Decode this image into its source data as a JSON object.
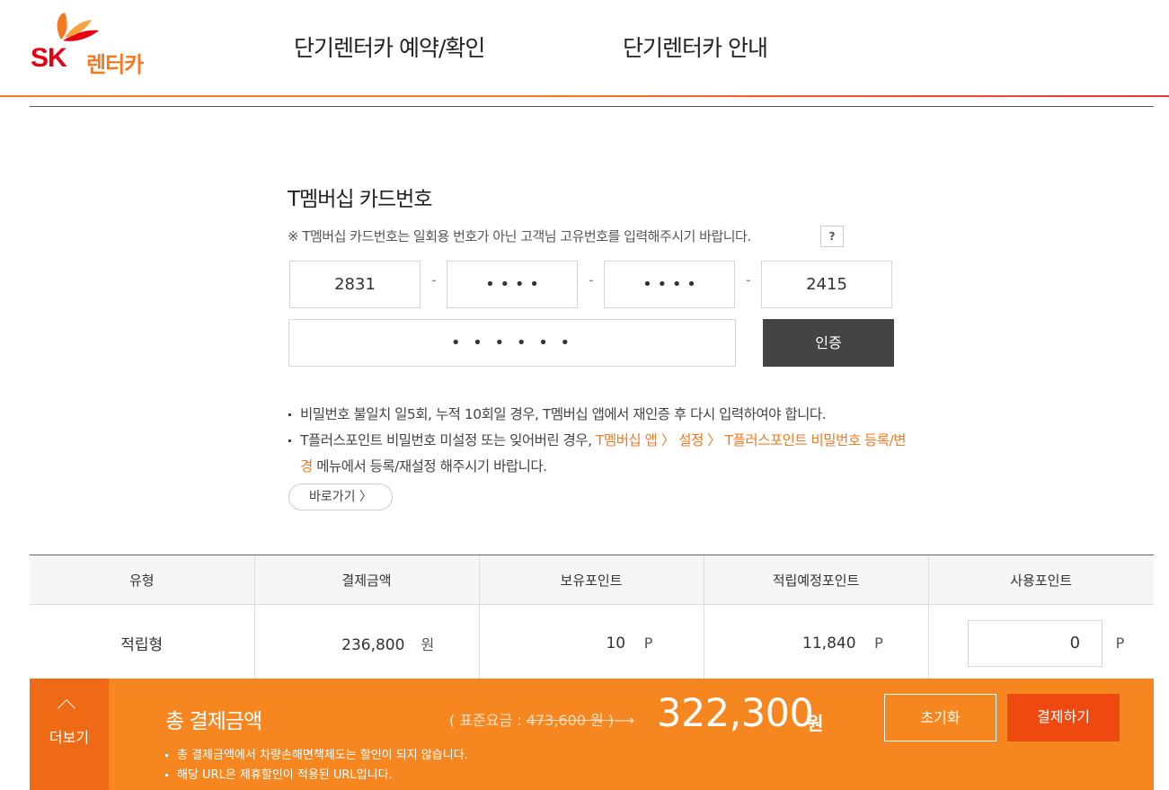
{
  "header": {
    "logo_text": "SK",
    "logo_sub": "렌터카",
    "nav": [
      "단기렌터카 예약/확인",
      "단기렌터카 안내"
    ]
  },
  "membership": {
    "title": "T멤버십 카드번호",
    "notice": "※ T멤버십 카드번호는 일회용 번호가 아닌 고객님 고유번호를 입력해주시기 바랍니다.",
    "help_label": "?",
    "card_parts": [
      "2831",
      "• • • •",
      "• • • •",
      "2415"
    ],
    "separator": "-",
    "password": "• • • • • •",
    "auth_label": "인증",
    "bullet1": "비밀번호 불일치 일5회, 누적 10회일 경우, T멤버십 앱에서 재인증 후 다시 입력하여야 합니다.",
    "bullet2_pre": "T플러스포인트 비밀번호 미설정 또는 잊어버린 경우, ",
    "bullet2_highlight": "T멤버십 앱 〉 설정 〉 T플러스포인트 비밀번호 등록/변경",
    "bullet2_post": " 메뉴에서 등록/재설정 해주시기 바랍니다.",
    "goto_label": "바로가기 〉"
  },
  "table": {
    "headers": [
      "유형",
      "결제금액",
      "보유포인트",
      "적립예정포인트",
      "사용포인트"
    ],
    "row": {
      "type": "적립형",
      "amount": "236,800",
      "amount_unit": "원",
      "held": "10",
      "held_unit": "P",
      "expected": "11,840",
      "expected_unit": "P",
      "use": "0",
      "use_unit": "P"
    }
  },
  "bottom": {
    "more_label": "더보기",
    "total_label": "총 결제금액",
    "std_prefix": "( 표준요금 : ",
    "std_value": "473,600 원 )",
    "std_arrow": "⟶",
    "total_amount": "322,300",
    "total_unit": "원",
    "notes": [
      "총 결제금액에서 차량손해면책제도는 할인이 되지 않습니다.",
      "해당 URL은 제휴할인이 적용된 URL입니다."
    ],
    "reset_label": "초기화",
    "pay_label": "결제하기"
  },
  "colors": {
    "brand_red": "#e60012",
    "brand_orange": "#f47920",
    "bar_orange": "#f58620",
    "pay_button": "#ee4a10",
    "auth_button": "#444444"
  }
}
